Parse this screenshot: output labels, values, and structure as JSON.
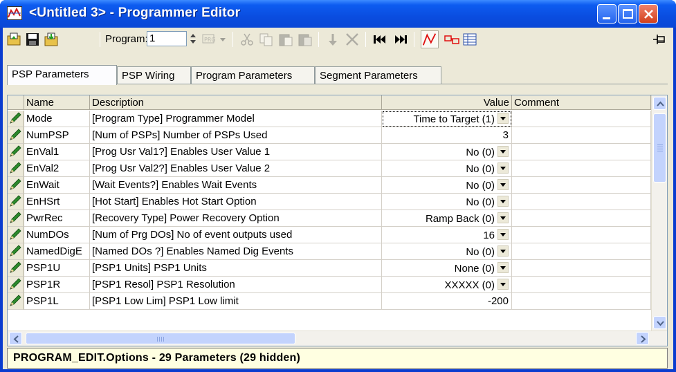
{
  "window": {
    "title": "<Untitled 3> - Programmer Editor",
    "controls": [
      "minimize",
      "maximize",
      "close"
    ]
  },
  "toolbar": {
    "program_label": "Program:",
    "program_value": "1",
    "buttons": [
      "open-icon",
      "save-icon",
      "save-as-icon",
      "program-select-icon",
      "cut-icon",
      "copy-icon",
      "paste-icon",
      "paste-special-icon",
      "insert-icon",
      "delete-icon",
      "first-icon",
      "last-icon",
      "graph-icon",
      "wiring-icon",
      "table-icon",
      "pin-icon"
    ]
  },
  "tabs": [
    {
      "label": "PSP Parameters",
      "active": true
    },
    {
      "label": "PSP Wiring",
      "active": false
    },
    {
      "label": "Program Parameters",
      "active": false
    },
    {
      "label": "Segment Parameters",
      "active": false
    }
  ],
  "grid": {
    "columns": [
      "Name",
      "Description",
      "Value",
      "Comment"
    ],
    "rows": [
      {
        "name": "Mode",
        "description": "[Program Type]  Programmer Model",
        "value": "Time to Target (1)",
        "dropdown": true,
        "focused": true
      },
      {
        "name": "NumPSP",
        "description": "[Num of PSPs]  Number of PSPs Used",
        "value": "3",
        "dropdown": false
      },
      {
        "name": "EnVal1",
        "description": "[Prog Usr Val1?]  Enables User Value 1",
        "value": "No (0)",
        "dropdown": true
      },
      {
        "name": "EnVal2",
        "description": "[Prog Usr Val2?]  Enables User Value 2",
        "value": "No (0)",
        "dropdown": true
      },
      {
        "name": "EnWait",
        "description": "[Wait Events?]  Enables Wait Events",
        "value": "No (0)",
        "dropdown": true
      },
      {
        "name": "EnHSrt",
        "description": "[Hot Start]  Enables Hot Start Option",
        "value": "No (0)",
        "dropdown": true
      },
      {
        "name": "PwrRec",
        "description": "[Recovery Type]  Power Recovery Option",
        "value": "Ramp Back (0)",
        "dropdown": true
      },
      {
        "name": "NumDOs",
        "description": "[Num of Prg DOs]  No of event outputs used",
        "value": "16",
        "dropdown": true
      },
      {
        "name": "NamedDigE",
        "description": "[Named DOs ?]  Enables Named Dig Events",
        "value": "No (0)",
        "dropdown": true
      },
      {
        "name": "PSP1U",
        "description": "[PSP1 Units]  PSP1 Units",
        "value": "None (0)",
        "dropdown": true
      },
      {
        "name": "PSP1R",
        "description": "[PSP1 Resol]  PSP1 Resolution",
        "value": "XXXXX (0)",
        "dropdown": true
      },
      {
        "name": "PSP1L",
        "description": "[PSP1 Low Lim]  PSP1 Low limit",
        "value": "-200",
        "dropdown": false
      }
    ]
  },
  "status": {
    "text": "PROGRAM_EDIT.Options  -  29 Parameters (29 hidden)"
  },
  "colors": {
    "titlebar": "#0a4de0",
    "face": "#ece9d8",
    "status_bg": "#ffffe1"
  }
}
